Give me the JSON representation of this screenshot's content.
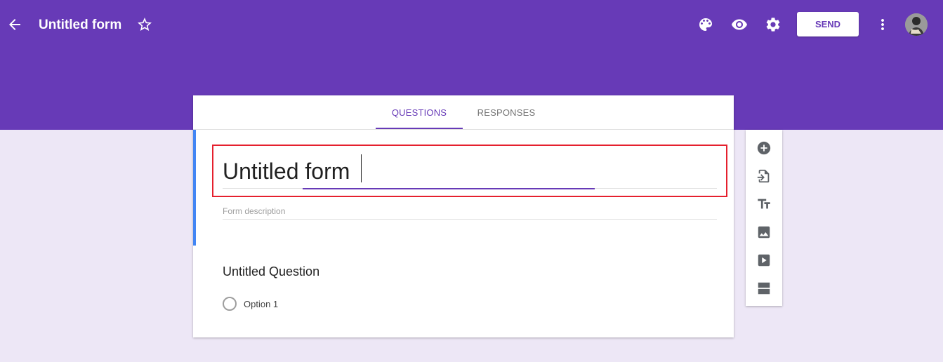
{
  "header": {
    "form_name": "Untitled form",
    "send_label": "SEND",
    "icons": {
      "back": "arrow-back-icon",
      "star": "star-outline-icon",
      "palette": "palette-icon",
      "preview": "eye-icon",
      "settings": "gear-icon",
      "more": "more-vert-icon",
      "avatar": "avatar-icon"
    },
    "colors": {
      "band": "#673ab7",
      "send_text": "#673ab7"
    }
  },
  "tabs": [
    {
      "label": "QUESTIONS",
      "active": true
    },
    {
      "label": "RESPONSES",
      "active": false
    }
  ],
  "form": {
    "title_value": "Untitled form",
    "description_placeholder": "Form description",
    "accent_color": "#4285f4"
  },
  "question": {
    "title": "Untitled Question",
    "options": [
      {
        "label": "Option 1"
      }
    ]
  },
  "toolbar": {
    "items": [
      "add-question-icon",
      "import-questions-icon",
      "add-title-icon",
      "add-image-icon",
      "add-video-icon",
      "add-section-icon"
    ]
  }
}
